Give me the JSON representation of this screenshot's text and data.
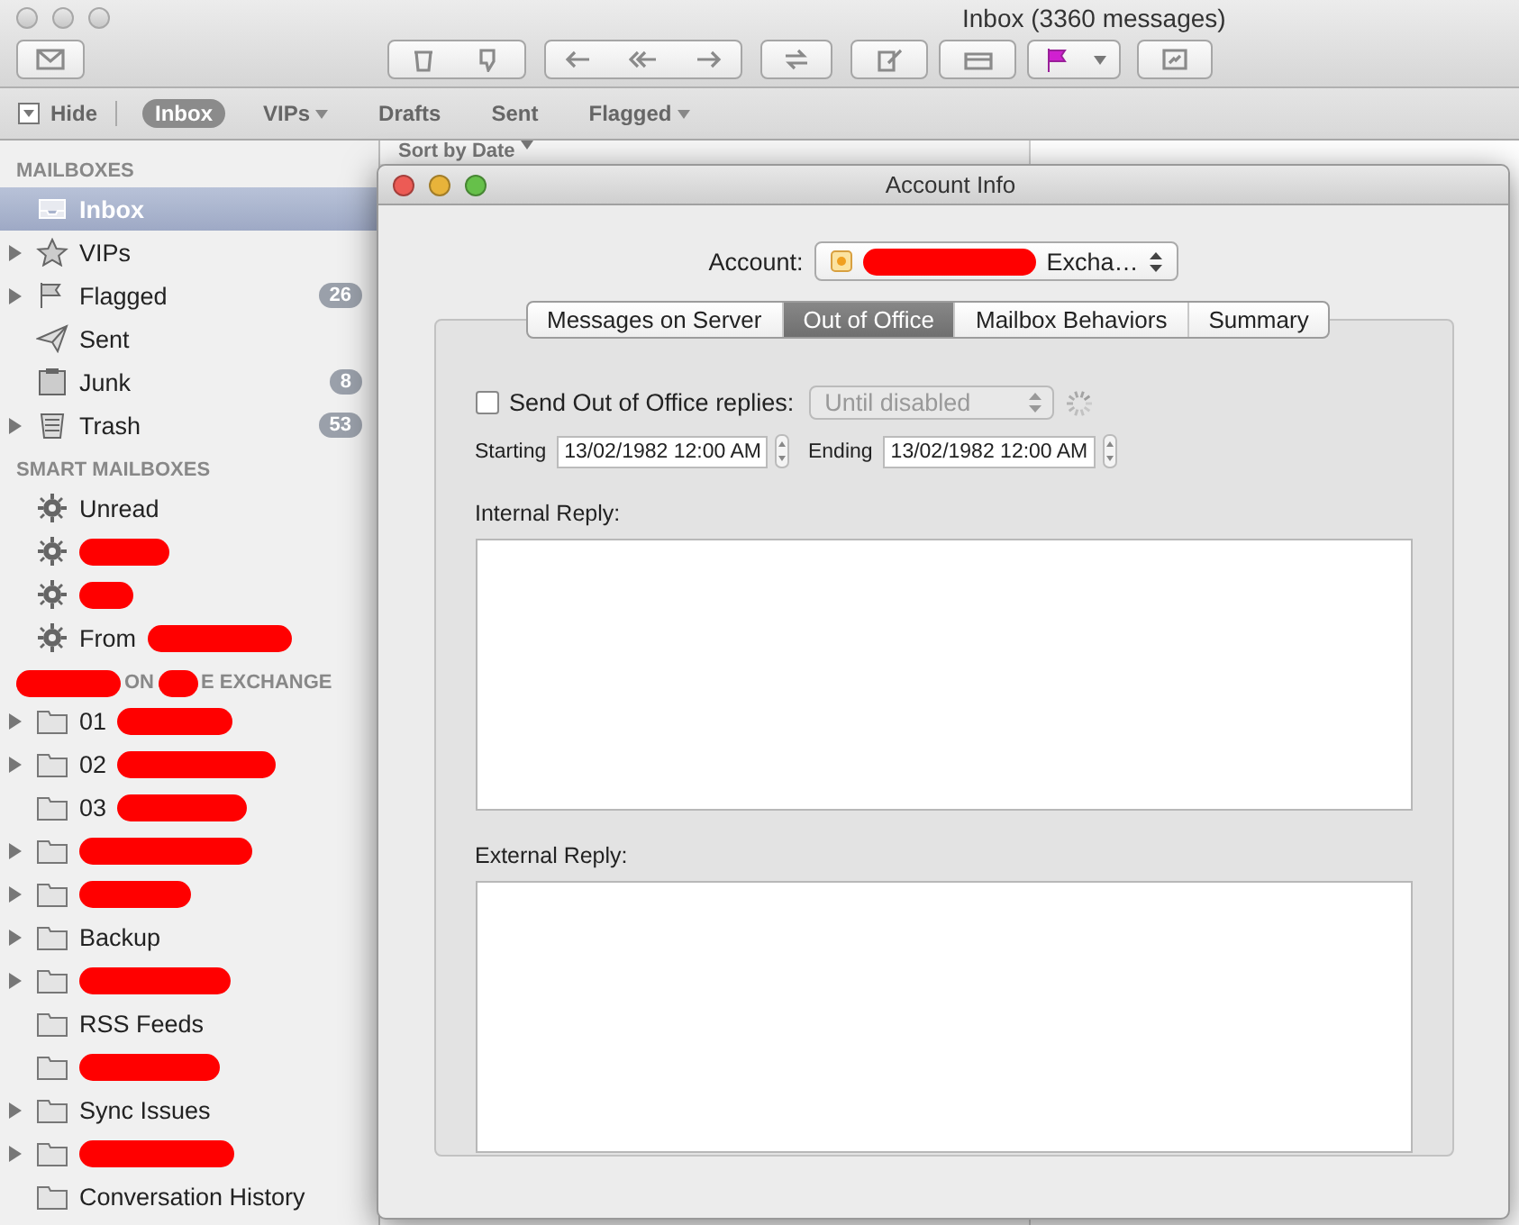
{
  "window": {
    "title": "Inbox (3360 messages)"
  },
  "favorites_bar": {
    "hide_label": "Hide",
    "items": [
      {
        "label": "Inbox",
        "selected": true
      },
      {
        "label": "VIPs",
        "selected": false,
        "has_menu": true
      },
      {
        "label": "Drafts",
        "selected": false
      },
      {
        "label": "Sent",
        "selected": false
      },
      {
        "label": "Flagged",
        "selected": false,
        "has_menu": true
      }
    ]
  },
  "sidebar": {
    "sections": [
      {
        "title_parts": [
          "MAILBOXES"
        ],
        "items": [
          {
            "label": "Inbox",
            "kind": "inbox",
            "selected": true
          },
          {
            "label": "VIPs",
            "kind": "star",
            "expanded": false,
            "selected": false
          },
          {
            "label": "Flagged",
            "kind": "flag",
            "expanded": false,
            "selected": false,
            "badge": "26"
          },
          {
            "label": "Sent",
            "kind": "sent",
            "selected": false
          },
          {
            "label": "Junk",
            "kind": "junk",
            "selected": false,
            "badge": "8"
          },
          {
            "label": "Trash",
            "kind": "trash",
            "expanded": false,
            "selected": false,
            "badge": "53"
          }
        ]
      },
      {
        "title_parts": [
          "SMART MAILBOXES"
        ],
        "items": [
          {
            "label": "Unread",
            "kind": "gear",
            "selected": false
          },
          {
            "kind": "gear",
            "selected": false,
            "redacted": true
          },
          {
            "kind": "gear",
            "selected": false,
            "redacted": true
          },
          {
            "label": "From",
            "kind": "gear",
            "selected": false,
            "redacted": true
          }
        ]
      },
      {
        "title_parts": [
          "ON",
          "E EXCHANGE"
        ],
        "redacted": true,
        "items": [
          {
            "label": "01",
            "kind": "folder",
            "expanded": false,
            "selected": false,
            "redacted": true
          },
          {
            "label": "02",
            "kind": "folder",
            "expanded": false,
            "selected": false,
            "redacted": true
          },
          {
            "label": "03",
            "kind": "folder",
            "selected": false,
            "redacted": true
          },
          {
            "kind": "folder",
            "expanded": false,
            "selected": false,
            "redacted": true
          },
          {
            "kind": "folder",
            "expanded": false,
            "selected": false,
            "redacted": true
          },
          {
            "label": "Backup",
            "kind": "folder",
            "expanded": false,
            "selected": false
          },
          {
            "kind": "folder",
            "expanded": false,
            "selected": false,
            "redacted": true
          },
          {
            "label": "RSS Feeds",
            "kind": "folder",
            "selected": false
          },
          {
            "kind": "folder",
            "selected": false,
            "redacted": true
          },
          {
            "label": "Sync Issues",
            "kind": "folder",
            "expanded": false,
            "selected": false
          },
          {
            "kind": "folder",
            "expanded": false,
            "selected": false,
            "redacted": true
          },
          {
            "label": "Conversation History",
            "kind": "folder",
            "selected": false
          }
        ]
      }
    ]
  },
  "message_list": {
    "sort_label": "Sort by Date"
  },
  "dialog": {
    "title": "Account Info",
    "account": {
      "label": "Account:",
      "value": "Excha…",
      "redacted": true
    },
    "tabs": [
      {
        "label": "Messages on Server",
        "selected": false
      },
      {
        "label": "Out of Office",
        "selected": true
      },
      {
        "label": "Mailbox Behaviors",
        "selected": false
      },
      {
        "label": "Summary",
        "selected": false
      }
    ],
    "send_replies": {
      "label": "Send Out of Office replies:",
      "checked": false
    },
    "duration": {
      "value": "Until disabled",
      "disabled": true
    },
    "starting": {
      "label": "Starting",
      "value": "13/02/1982 12:00 AM"
    },
    "ending": {
      "label": "Ending",
      "value": "13/02/1982 12:00 AM"
    },
    "internal_reply": {
      "label": "Internal Reply:"
    },
    "external_reply": {
      "label": "External Reply:"
    }
  }
}
